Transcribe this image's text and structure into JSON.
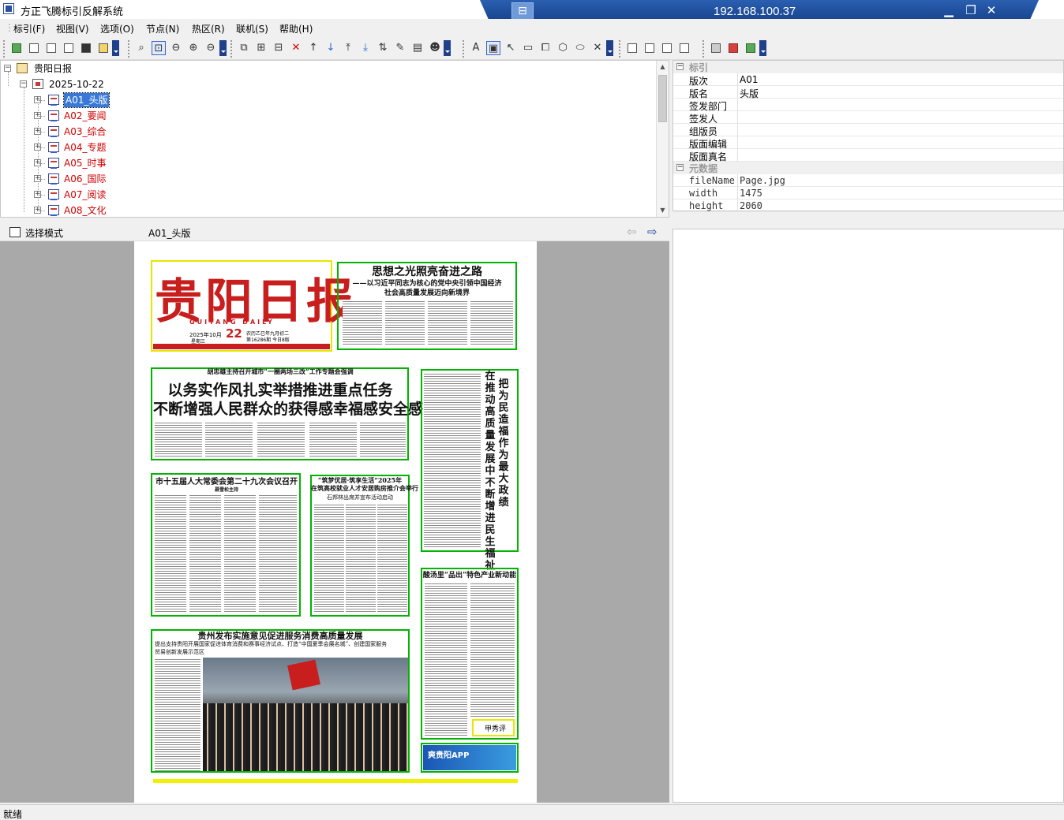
{
  "window": {
    "title": "方正飞腾标引反解系统"
  },
  "remote": {
    "ip": "192.168.100.37",
    "pin_icon": "pin-icon",
    "min": "▁",
    "restore": "❐",
    "close": "✕"
  },
  "menu": [
    "标引(F)",
    "视图(V)",
    "选项(O)",
    "节点(N)",
    "热区(R)",
    "联机(S)",
    "帮助(H)"
  ],
  "tree": {
    "root": "贵阳日报",
    "date": "2025-10-22",
    "pages": [
      "A01_头版",
      "A02_要闻",
      "A03_综合",
      "A04_专题",
      "A05_时事",
      "A06_国际",
      "A07_阅读",
      "A08_文化"
    ],
    "selected_index": 0
  },
  "properties": {
    "cat1": "标引",
    "rows1": [
      {
        "k": "版次",
        "v": "A01"
      },
      {
        "k": "版名",
        "v": "头版"
      },
      {
        "k": "签发部门",
        "v": ""
      },
      {
        "k": "签发人",
        "v": ""
      },
      {
        "k": "组版员",
        "v": ""
      },
      {
        "k": "版面编辑",
        "v": ""
      },
      {
        "k": "版面真名",
        "v": ""
      }
    ],
    "cat2": "元数据",
    "rows2": [
      {
        "k": "fileName",
        "v": "Page.jpg"
      },
      {
        "k": "width",
        "v": "1475"
      },
      {
        "k": "height",
        "v": "2060"
      }
    ]
  },
  "viewer": {
    "mode": "选择模式",
    "page": "A01_头版",
    "prev": "⇦",
    "next": "⇨"
  },
  "newspaper": {
    "masthead": "贵阳日报",
    "masthead_en": "GUIYANG DAILY",
    "issue_date": "2025年10月",
    "issue_day": "22",
    "issue_week": "星期三",
    "issue_lunar": "农历乙巳年九月初二",
    "issue_no": "第16286期 今日8版",
    "h1": "思想之光照亮奋进之路",
    "h1_sub": "——以习近平同志为核心的党中央引领中国经济",
    "h1_sub2": "社会高质量发展迈向新境界",
    "kicker2": "胡忠雄主持召开城市“一圈两场三改”工作专题会强调",
    "h2a": "以务实作风扎实举措推进重点任务",
    "h2b": "不断增强人民群众的获得感幸福感安全感",
    "h3": "在推动高质量发展中不断增进民生福祉",
    "h3b": "把为民造福作为最大政绩",
    "h4": "市十五届人大常委会第二十九次会议召开",
    "h4_sub": "聂雪松主持",
    "h5_kicker": "“筑梦优居·筑享生活”2025年",
    "h5": "在筑高校就业人才安居购房推介会举行",
    "h5_sub": "石邦林出席并宣布活动启动",
    "h6": "酸汤里“品出”特色产业新动能",
    "h7": "贵州发布实施意见促进服务消费高质量发展",
    "h7_sub": "提出支持贵阳开展国家促进体育消费和赛事经济试点、打造“中国夏季会展名城”、创建国家服务",
    "h7_sub2": "贸易创新发展示范区",
    "app": "爽贵阳APP",
    "comment": "甲秀评"
  },
  "status": "就绪"
}
